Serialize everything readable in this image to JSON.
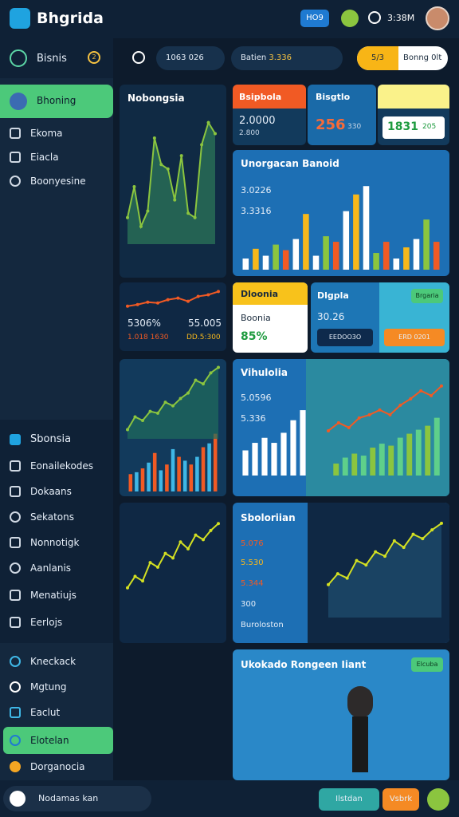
{
  "header": {
    "title": "Bhgrida",
    "tag": "HO9",
    "time": "3:38M"
  },
  "sidebar": {
    "head_label": "Bisnis",
    "head_badge": "2",
    "active": "Bhoning",
    "items": [
      {
        "label": "Ekoma"
      },
      {
        "label": "Eiacla"
      },
      {
        "label": "Boonyesine"
      }
    ],
    "section2": [
      {
        "label": "Sbonsia"
      },
      {
        "label": "Eonailekodes"
      },
      {
        "label": "Dokaans"
      },
      {
        "label": "Sekatons"
      },
      {
        "label": "Nonnotigk"
      },
      {
        "label": "Aanlanis"
      },
      {
        "label": "Menatiujs"
      },
      {
        "label": "Eerlojs"
      }
    ],
    "section3": [
      {
        "label": "Kneckack"
      },
      {
        "label": "Mgtung"
      },
      {
        "label": "Eaclut"
      },
      {
        "label": "Elotelan"
      },
      {
        "label": "Dorganocia"
      }
    ]
  },
  "toolbar": {
    "pill1": "1063 026",
    "pill2_label": "Batien",
    "pill2_value": "3.336",
    "yellow_left": "5/3",
    "yellow_right": "Bonng 0lt"
  },
  "cards": {
    "c1_title": "Nobongsia",
    "c2a": {
      "title": "Bsipbola",
      "value": "2.0000",
      "sub": "2.800"
    },
    "c2b": {
      "title": "Bisgtlo",
      "value": "256",
      "sub": "330"
    },
    "c2c": {
      "value": "1831",
      "sub": "205"
    },
    "c3": {
      "title": "Unorgacan Banoid",
      "v1": "3.0226",
      "v2": "3.3316"
    },
    "c4": {
      "v1": "5306%",
      "v2": "55.005",
      "v3": "1.018 1630",
      "v4": "DD.5:300"
    },
    "c5": {
      "title": "Dloonia",
      "value": "Boonia",
      "pct": "85%"
    },
    "c6": {
      "title": "Dlgpla",
      "value": "30.26",
      "btn1": "EEDOO3O",
      "btn2": "ERD 0201",
      "tag": "Brgaria"
    },
    "c8": {
      "title": "Vihulolia",
      "v1": "5.0596",
      "v2": "5.336"
    },
    "c10": {
      "title": "Sboloriian",
      "v1": "5.076",
      "v2": "5.530",
      "v3": "5.344",
      "v4": "300",
      "v5": "Buroloston"
    },
    "c11": {
      "title": "Ukokado Rongeen Iiant",
      "tag": "Elcuba"
    }
  },
  "footer": {
    "search": "Nodamas kan",
    "btn1": "Ilstdan",
    "btn2": "Vsbrk"
  },
  "chart_data": [
    {
      "type": "line",
      "series": [
        {
          "values": [
            12,
            26,
            8,
            15,
            48,
            36,
            34,
            20,
            40,
            14,
            12,
            45,
            55,
            50
          ]
        }
      ]
    },
    {
      "type": "bar",
      "series": [
        {
          "values": [
            8,
            15,
            10,
            18,
            14,
            22,
            40,
            10,
            24,
            20,
            42,
            54,
            60,
            12,
            20,
            8,
            16,
            22,
            36,
            20
          ]
        }
      ]
    },
    {
      "type": "line",
      "series": [
        {
          "values": [
            10,
            12,
            15,
            14,
            18,
            20,
            16,
            22,
            24,
            28
          ]
        }
      ]
    },
    {
      "type": "bar",
      "series": [
        {
          "values": [
            18,
            20,
            24,
            30,
            40,
            22,
            28,
            44,
            36,
            32,
            28,
            36,
            46,
            50,
            60
          ]
        }
      ]
    },
    {
      "type": "line",
      "series": [
        {
          "values": [
            10,
            24,
            20,
            30,
            28,
            40,
            36,
            44,
            50,
            64,
            60,
            72,
            78
          ]
        }
      ]
    },
    {
      "type": "bar",
      "series": [
        {
          "values": [
            20,
            26,
            30,
            26,
            34,
            44,
            52
          ]
        }
      ]
    },
    {
      "type": "line",
      "series": [
        {
          "values": [
            20,
            30,
            24,
            36,
            40,
            46,
            40,
            52,
            60,
            70,
            64,
            76
          ]
        }
      ]
    },
    {
      "type": "line",
      "series": [
        {
          "values": [
            30,
            40,
            36,
            52,
            48,
            60,
            56,
            70,
            64,
            76,
            72,
            80,
            86
          ]
        }
      ]
    },
    {
      "type": "bar",
      "series": [
        {
          "values": [
            12,
            18,
            22,
            20,
            28,
            32,
            30,
            38,
            42,
            46,
            50,
            58
          ]
        }
      ]
    }
  ]
}
